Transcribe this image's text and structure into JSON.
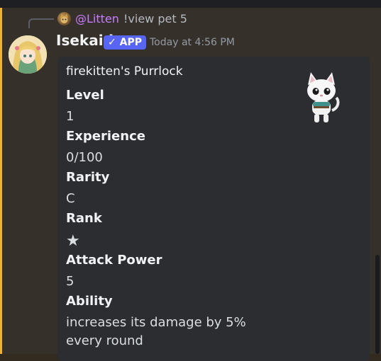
{
  "reply": {
    "username": "@Litten",
    "command": "!view pet 5"
  },
  "message": {
    "author": "Isekaid",
    "badge": "✓ APP",
    "timestamp": "Today at 4:56 PM"
  },
  "embed": {
    "title": "firekitten's Purrlock",
    "fields": [
      {
        "name": "Level",
        "value": "1"
      },
      {
        "name": "Experience",
        "value": "0/100"
      },
      {
        "name": "Rarity",
        "value": "C"
      },
      {
        "name": "Rank",
        "value": "★"
      },
      {
        "name": "Attack Power",
        "value": "5"
      },
      {
        "name": "Ability",
        "value": "increases its damage by 5% every round"
      }
    ]
  },
  "colors": {
    "highlight": "#35302a",
    "mention_bar": "#f0b232",
    "embed_bg": "#2b2d31",
    "app_badge": "#5865f2",
    "reply_name": "#c77dff"
  }
}
